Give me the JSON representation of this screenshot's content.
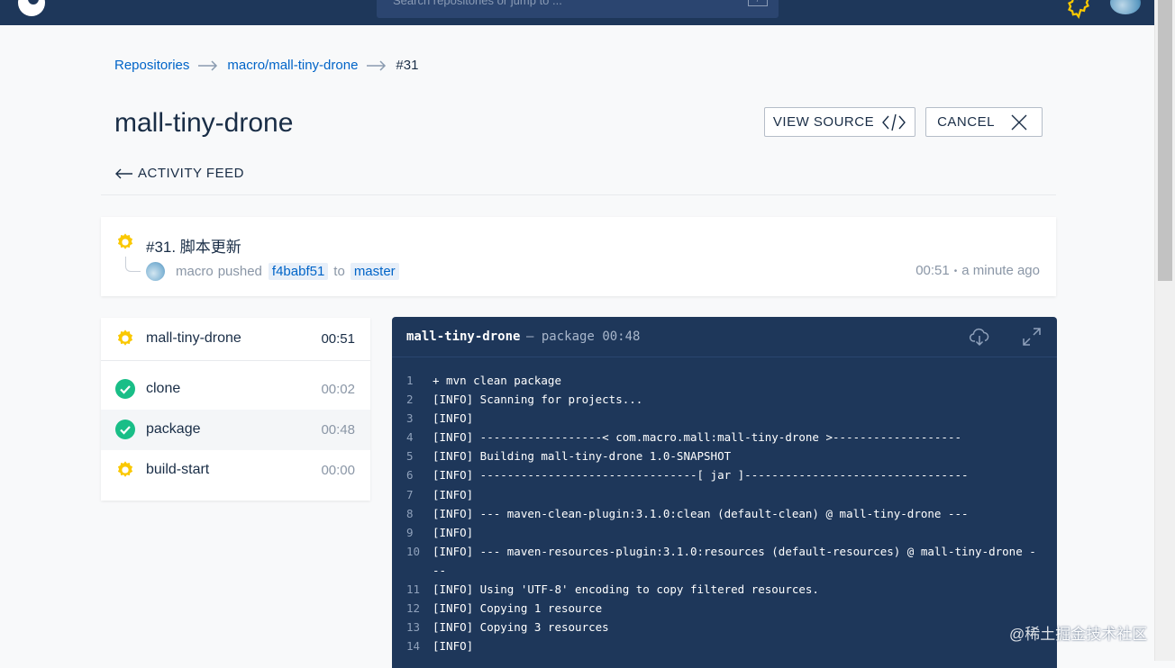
{
  "topnav": {
    "search_placeholder": "Search repositories or jump to ...",
    "search_shortcut": "/"
  },
  "breadcrumb": {
    "root": "Repositories",
    "repo": "macro/mall-tiny-drone",
    "build": "#31"
  },
  "page": {
    "title": "mall-tiny-drone",
    "view_source_label": "VIEW SOURCE",
    "cancel_label": "CANCEL",
    "activity_feed_label": "ACTIVITY FEED"
  },
  "build": {
    "title": "#31. 脚本更新",
    "author": "macro",
    "action": "pushed",
    "commit": "f4babf51",
    "to_word": "to",
    "branch": "master",
    "duration": "00:51",
    "relative_time": "a minute ago"
  },
  "stages": {
    "pipeline_name": "mall-tiny-drone",
    "pipeline_duration": "00:51",
    "items": [
      {
        "name": "clone",
        "duration": "00:02",
        "status": "success"
      },
      {
        "name": "package",
        "duration": "00:48",
        "status": "success"
      },
      {
        "name": "build-start",
        "duration": "00:00",
        "status": "running"
      }
    ]
  },
  "log": {
    "pipeline": "mall-tiny-drone",
    "step": "package",
    "elapsed": "00:48",
    "lines": [
      {
        "n": "1",
        "t": "+ mvn clean package"
      },
      {
        "n": "2",
        "t": "[INFO] Scanning for projects..."
      },
      {
        "n": "3",
        "t": "[INFO]"
      },
      {
        "n": "4",
        "t": "[INFO] ------------------< com.macro.mall:mall-tiny-drone >-------------------"
      },
      {
        "n": "5",
        "t": "[INFO] Building mall-tiny-drone 1.0-SNAPSHOT"
      },
      {
        "n": "6",
        "t": "[INFO] --------------------------------[ jar ]---------------------------------"
      },
      {
        "n": "7",
        "t": "[INFO]"
      },
      {
        "n": "8",
        "t": "[INFO] --- maven-clean-plugin:3.1.0:clean (default-clean) @ mall-tiny-drone ---"
      },
      {
        "n": "9",
        "t": "[INFO]"
      },
      {
        "n": "10",
        "t": "[INFO] --- maven-resources-plugin:3.1.0:resources (default-resources) @ mall-tiny-drone ---"
      },
      {
        "n": "11",
        "t": "[INFO] Using 'UTF-8' encoding to copy filtered resources."
      },
      {
        "n": "12",
        "t": "[INFO] Copying 1 resource"
      },
      {
        "n": "13",
        "t": "[INFO] Copying 3 resources"
      },
      {
        "n": "14",
        "t": "[INFO]"
      }
    ]
  },
  "watermark": "@稀土掘金技术社区",
  "colors": {
    "nav": "#1e375a",
    "link": "#0064c8",
    "success": "#19be87",
    "running": "#fac800"
  }
}
